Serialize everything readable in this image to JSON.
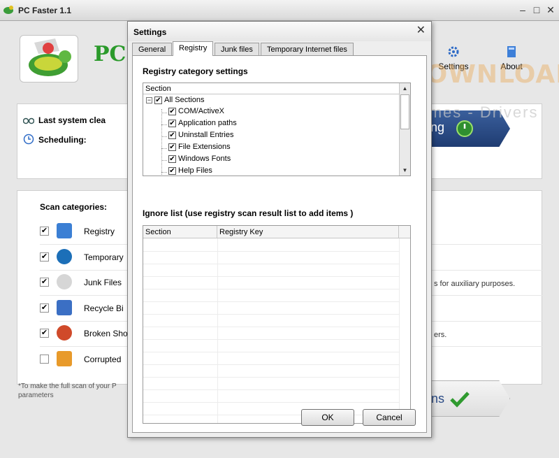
{
  "main_window": {
    "title": "PC Faster 1.1",
    "logo_text": "PC f",
    "settings_label": "Settings",
    "about_label": "About",
    "last_clean_label": "Last system clea",
    "scheduling_label": "Scheduling:",
    "action_button_text": "ng",
    "scan_button_text": "ns",
    "scan_categories_label": "Scan categories:",
    "scan_items": [
      {
        "label": "Registry",
        "checked": true,
        "icon": "registry-icon",
        "color": "#3b7fd4"
      },
      {
        "label": "Temporary",
        "checked": true,
        "icon": "globe-icon",
        "color": "#1c6fb8"
      },
      {
        "label": "Junk Files",
        "checked": true,
        "icon": "crumpled-paper-icon",
        "color": "#cfcfcf"
      },
      {
        "label": "Recycle Bi",
        "checked": true,
        "icon": "recycle-bin-icon",
        "color": "#3b6fc4"
      },
      {
        "label": "Broken Sho",
        "checked": true,
        "icon": "broken-shortcut-icon",
        "color": "#d04a2a"
      },
      {
        "label": "Corrupted",
        "checked": false,
        "icon": "corrupted-file-icon",
        "color": "#e89a2a"
      }
    ],
    "note_auxiliary": "s for auxiliary purposes.",
    "note_ers": "ers.",
    "footnote": "*To make the full scan of your P parameters"
  },
  "watermark": {
    "main": "FIBERDOWNLOAD",
    "sub": "Software - Games - Drivers"
  },
  "dialog": {
    "title": "Settings",
    "tabs": [
      "General",
      "Registry",
      "Junk files",
      "Temporary Internet files"
    ],
    "active_tab": "Registry",
    "registry_section_title": "Registry category settings",
    "tree_header": "Section",
    "tree_root": "All Sections",
    "tree_items": [
      "COM/ActiveX",
      "Application paths",
      "Uninstall Entries",
      "File Extensions",
      "Windows Fonts",
      "Help Files"
    ],
    "ignore_title": "Ignore list (use registry scan result list to add items )",
    "grid_columns": [
      "Section",
      "Registry Key"
    ],
    "ok_label": "OK",
    "cancel_label": "Cancel"
  },
  "colors": {
    "accent_green": "#2b9a2b",
    "button_blue": "#2a4a85",
    "watermark_orange": "#e8aa5a"
  }
}
